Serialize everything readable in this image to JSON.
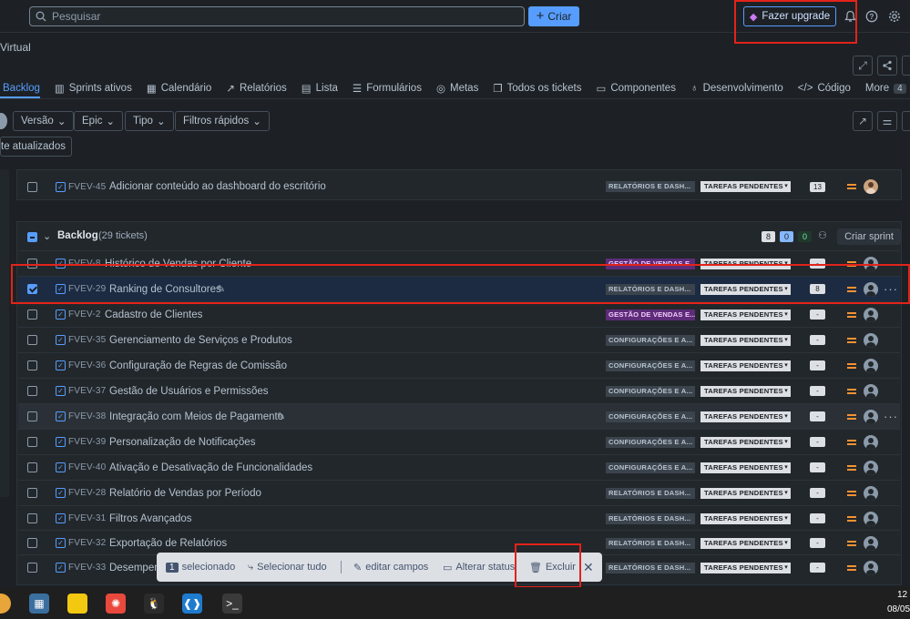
{
  "topbar": {
    "search_placeholder": "Pesquisar",
    "create_label": "Criar",
    "upgrade_label": "Fazer upgrade"
  },
  "project": {
    "name_partial": "Virtual"
  },
  "tabs": [
    {
      "label": "Backlog",
      "active": true
    },
    {
      "label": "Sprints ativos"
    },
    {
      "label": "Calendário"
    },
    {
      "label": "Relatórios"
    },
    {
      "label": "Lista"
    },
    {
      "label": "Formulários"
    },
    {
      "label": "Metas"
    },
    {
      "label": "Todos os tickets"
    },
    {
      "label": "Componentes"
    },
    {
      "label": "Desenvolvimento"
    },
    {
      "label": "Código"
    }
  ],
  "tabs_more": {
    "label": "More",
    "count": "4"
  },
  "filters": {
    "versao": "Versão",
    "epic": "Epic",
    "tipo": "Tipo",
    "filtros_rapidos": "Filtros rápidos",
    "updated_partial": "te atualizados"
  },
  "sprint_row": {
    "key": "FVEV-45",
    "summary": "Adicionar conteúdo ao dashboard do escritório",
    "epic": "RELATÓRIOS E DASH...",
    "status": "TAREFAS PENDENTES",
    "estimate": "13"
  },
  "backlog": {
    "title": "Backlog",
    "count_label": "(29 tickets)",
    "counts": {
      "todo": "8",
      "inprogress": "0",
      "done": "0"
    },
    "create_sprint": "Criar sprint"
  },
  "rows": [
    {
      "key": "FVEV-8",
      "summary": "Histórico de Vendas por Cliente",
      "epic": "GESTÃO DE VENDAS E...",
      "status": "TAREFAS PENDENTES",
      "estimate": "-"
    },
    {
      "key": "FVEV-29",
      "summary": "Ranking de Consultores",
      "epic": "RELATÓRIOS E DASH...",
      "status": "TAREFAS PENDENTES",
      "estimate": "8"
    },
    {
      "key": "FVEV-2",
      "summary": "Cadastro de Clientes",
      "epic": "GESTÃO DE VENDAS E...",
      "status": "TAREFAS PENDENTES",
      "estimate": "-"
    },
    {
      "key": "FVEV-35",
      "summary": "Gerenciamento de Serviços e Produtos",
      "epic": "CONFIGURAÇÕES E A...",
      "status": "TAREFAS PENDENTES",
      "estimate": "-"
    },
    {
      "key": "FVEV-36",
      "summary": "Configuração de Regras de Comissão",
      "epic": "CONFIGURAÇÕES E A...",
      "status": "TAREFAS PENDENTES",
      "estimate": "-"
    },
    {
      "key": "FVEV-37",
      "summary": "Gestão de Usuários e Permissões",
      "epic": "CONFIGURAÇÕES E A...",
      "status": "TAREFAS PENDENTES",
      "estimate": "-"
    },
    {
      "key": "FVEV-38",
      "summary": "Integração com Meios de Pagamento",
      "epic": "CONFIGURAÇÕES E A...",
      "status": "TAREFAS PENDENTES",
      "estimate": "-"
    },
    {
      "key": "FVEV-39",
      "summary": "Personalização de Notificações",
      "epic": "CONFIGURAÇÕES E A...",
      "status": "TAREFAS PENDENTES",
      "estimate": "-"
    },
    {
      "key": "FVEV-40",
      "summary": "Ativação e Desativação de Funcionalidades",
      "epic": "CONFIGURAÇÕES E A...",
      "status": "TAREFAS PENDENTES",
      "estimate": "-"
    },
    {
      "key": "FVEV-28",
      "summary": "Relatório de Vendas por Período",
      "epic": "RELATÓRIOS E DASH...",
      "status": "TAREFAS PENDENTES",
      "estimate": "-"
    },
    {
      "key": "FVEV-31",
      "summary": "Filtros Avançados",
      "epic": "RELATÓRIOS E DASH...",
      "status": "TAREFAS PENDENTES",
      "estimate": "-"
    },
    {
      "key": "FVEV-32",
      "summary": "Exportação de Relatórios",
      "epic": "RELATÓRIOS E DASH...",
      "status": "TAREFAS PENDENTES",
      "estimate": "-"
    },
    {
      "key": "FVEV-33",
      "summary": "Desempenho",
      "epic": "RELATÓRIOS E DASH...",
      "status": "TAREFAS PENDENTES",
      "estimate": "-"
    }
  ],
  "bulk_bar": {
    "selected_count": "1",
    "selected_label": "selecionado",
    "select_all": "Selecionar tudo",
    "edit_fields": "editar campos",
    "change_status": "Alterar status",
    "delete": "Excluir"
  },
  "taskbar": {
    "clock_partial": "12",
    "date_partial": "08/05"
  }
}
